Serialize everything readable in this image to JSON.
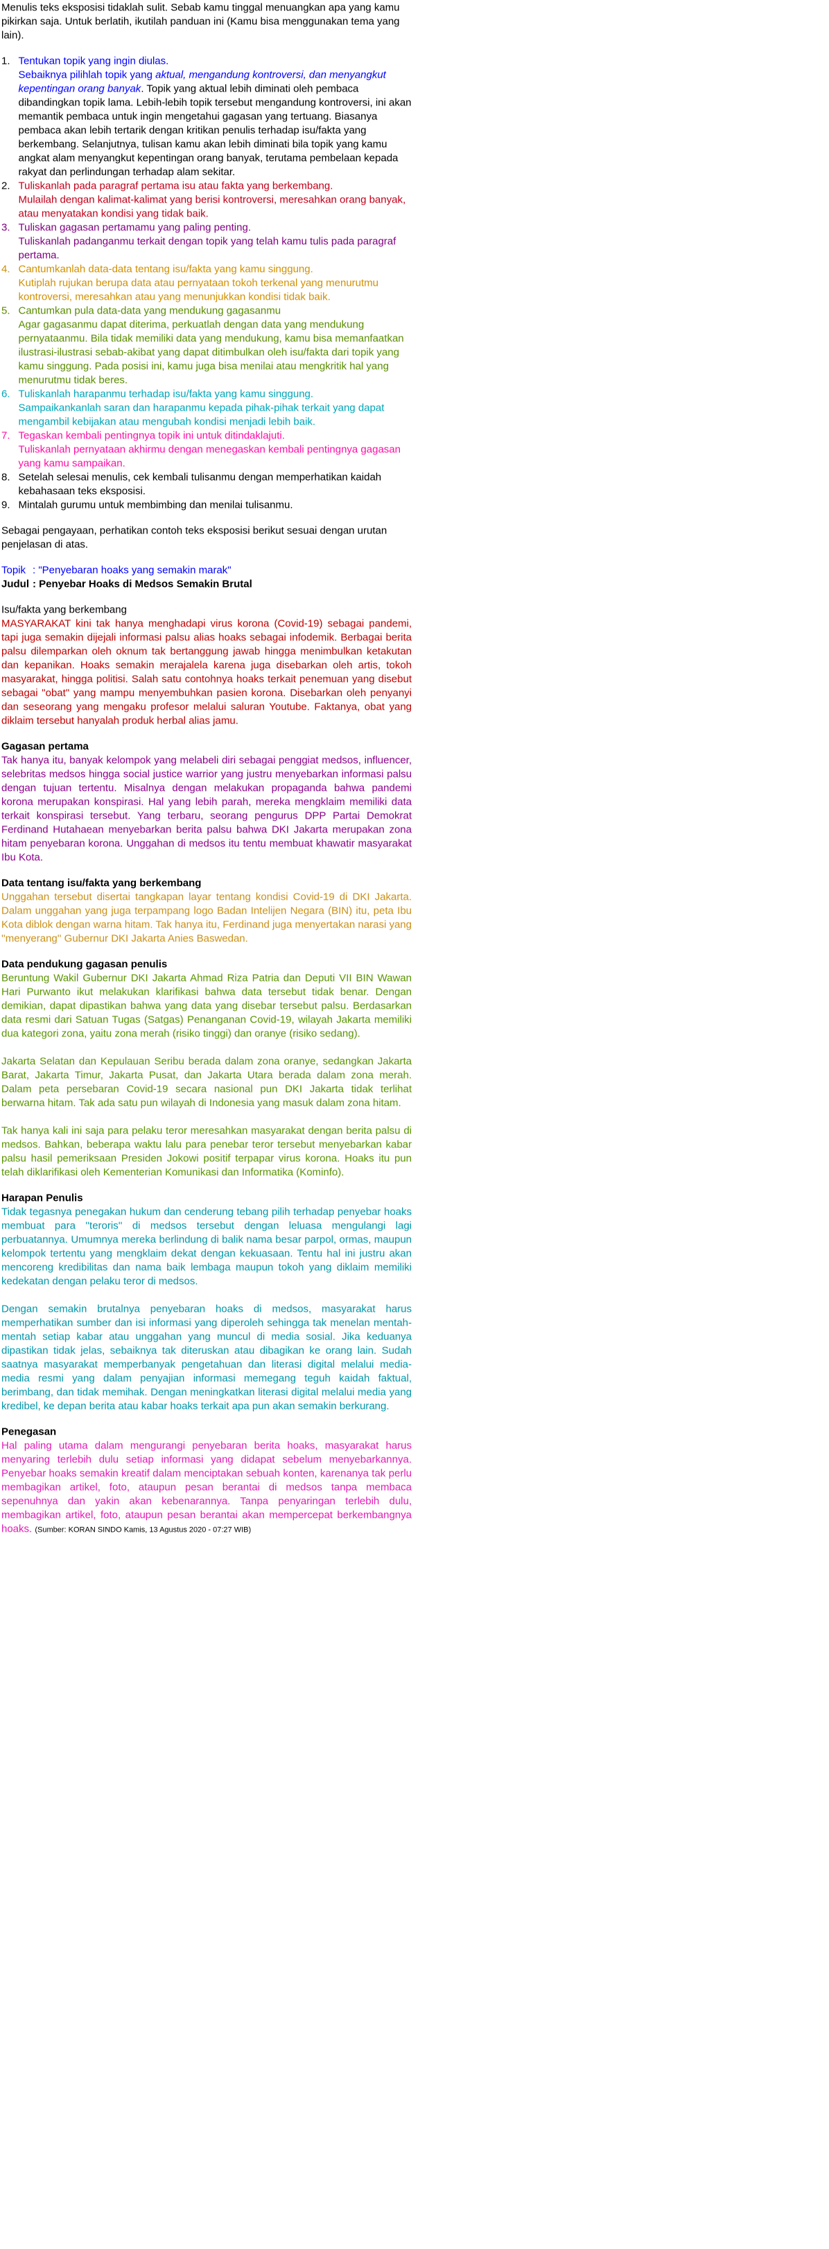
{
  "intro": "Menulis teks eksposisi tidaklah sulit. Sebab kamu tinggal menuangkan apa yang kamu pikirkan saja. Untuk berlatih, ikutilah panduan ini (Kamu bisa menggunakan tema yang lain).",
  "colors": {
    "blue": "#0000ff",
    "red": "#c0001a",
    "purple": "#800080",
    "orange": "#d19000",
    "green": "#5a8c00",
    "cyan": "#00a5b8",
    "pink": "#ff0da6"
  },
  "steps": [
    {
      "num": "1.",
      "title": "Tentukan topik yang ingin diulas.",
      "body_prefix": "Sebaiknya pilihlah topik yang ",
      "body_italic": "aktual, mengandung kontroversi, dan menyangkut  kepentingan orang banyak",
      "body_suffix": ". Topik yang aktual lebih diminati oleh pembaca dibandingkan  topik lama. Lebih-lebih topik tersebut mengandung kontroversi, ini akan memantik pembaca untuk ingin mengetahui gagasan yang tertuang. Biasanya pembaca akan lebih tertarik dengan kritikan penulis terhadap isu/fakta yang berkembang. Selanjutnya, tulisan  kamu akan lebih diminati bila topik yang kamu angkat alam menyangkut kepentingan orang banyak, terutama pembelaan kepada rakyat dan perlindungan terhadap alam sekitar."
    },
    {
      "num": "2.",
      "title": "Tuliskanlah pada paragraf pertama isu atau fakta yang berkembang.",
      "body": "Mulailah dengan kalimat-kalimat yang berisi kontroversi, meresahkan orang banyak, atau menyatakan kondisi yang tidak baik."
    },
    {
      "num": "3.",
      "title": "Tuliskan gagasan pertamamu yang paling penting.",
      "body": "Tuliskanlah padanganmu terkait dengan topik yang telah kamu tulis pada paragraf pertama."
    },
    {
      "num": "4.",
      "title": "Cantumkanlah data-data tentang isu/fakta yang kamu singgung.",
      "body": "Kutiplah rujukan berupa data atau pernyataan tokoh terkenal yang menurutmu kontroversi, meresahkan atau yang menunjukkan kondisi tidak baik."
    },
    {
      "num": "5.",
      "title": "Cantumkan pula data-data yang mendukung gagasanmu",
      "body": "Agar gagasanmu dapat diterima, perkuatlah dengan data yang mendukung pernyataanmu. Bila tidak memiliki data yang mendukung, kamu bisa memanfaatkan ilustrasi-ilustrasi sebab-akibat yang dapat ditimbulkan oleh isu/fakta dari topik yang kamu singgung. Pada posisi ini, kamu juga bisa menilai atau mengkritik hal yang menurutmu tidak beres."
    },
    {
      "num": "6.",
      "title": "Tuliskanlah harapanmu terhadap isu/fakta yang kamu singgung.",
      "body": "Sampaikankanlah saran dan harapanmu kepada pihak-pihak terkait yang dapat mengambil kebijakan atau mengubah kondisi menjadi lebih baik."
    },
    {
      "num": "7.",
      "title": "Tegaskan kembali pentingnya topik ini untuk ditindaklajuti.",
      "body": "Tuliskanlah pernyataan akhirmu dengan menegaskan kembali pentingnya gagasan yang kamu sampaikan."
    },
    {
      "num": "8.",
      "text": "Setelah selesai menulis, cek kembali tulisanmu dengan memperhatikan kaidah kebahasaan teks eksposisi."
    },
    {
      "num": "9.",
      "text": "Mintalah gurumu untuk membimbing dan menilai tulisanmu."
    }
  ],
  "enrichment": "Sebagai pengayaan, perhatikan contoh teks eksposisi berikut sesuai dengan urutan penjelasan di atas.",
  "topic_label": "Topik",
  "topic_value": ": \"Penyebaran hoaks yang semakin marak\"",
  "title_label": "Judul",
  "title_value": ": Penyebar Hoaks di Medsos Semakin Brutal",
  "sections": {
    "isu": {
      "heading": "Isu/fakta yang berkembang",
      "text": "MASYARAKAT kini tak hanya menghadapi virus korona (Covid-19) sebagai pandemi, tapi juga semakin dijejali informasi palsu alias hoaks sebagai infodemik. Berbagai berita palsu dilemparkan oleh oknum tak bertanggung jawab hingga menimbulkan ketakutan dan kepanikan. Hoaks semakin merajalela karena juga disebarkan oleh artis, tokoh masyarakat, hingga politisi. Salah satu contohnya hoaks terkait penemuan yang disebut sebagai \"obat\" yang mampu menyembuhkan pasien korona. Disebarkan oleh penyanyi dan seseorang yang mengaku profesor melalui saluran Youtube. Faktanya, obat yang diklaim tersebut hanyalah produk herbal alias jamu."
    },
    "gagasan": {
      "heading": "Gagasan pertama",
      "text": "Tak hanya itu, banyak kelompok yang melabeli diri sebagai penggiat medsos, influencer, selebritas medsos hingga social justice warrior yang justru menyebarkan informasi palsu dengan tujuan tertentu. Misalnya dengan melakukan propaganda bahwa pandemi korona merupakan konspirasi. Hal yang lebih parah, mereka mengklaim memiliki data terkait konspirasi tersebut. Yang terbaru, seorang pengurus DPP Partai Demokrat Ferdinand Hutahaean menyebarkan berita palsu bahwa DKI Jakarta merupakan zona hitam penyebaran korona. Unggahan di medsos itu tentu membuat khawatir masyarakat Ibu Kota."
    },
    "data": {
      "heading": "Data tentang isu/fakta yang berkembang",
      "text": "Unggahan tersebut disertai tangkapan layar tentang kondisi Covid-19 di DKI Jakarta. Dalam unggahan yang juga terpampang logo Badan Intelijen Negara (BIN) itu, peta Ibu Kota diblok dengan warna hitam. Tak hanya itu, Ferdinand juga menyertakan narasi yang ''menyerang'' Gubernur DKI Jakarta Anies Baswedan."
    },
    "pendukung": {
      "heading": "Data pendukung gagasan penulis",
      "p1": "Beruntung Wakil Gubernur DKI Jakarta Ahmad Riza Patria dan Deputi VII BIN Wawan Hari Purwanto ikut melakukan klarifikasi bahwa data tersebut tidak benar. Dengan demikian, dapat dipastikan bahwa yang data yang disebar tersebut palsu. Berdasarkan data resmi dari Satuan Tugas (Satgas) Penanganan Covid-19, wilayah Jakarta memiliki dua kategori zona, yaitu zona merah (risiko tinggi) dan oranye (risiko sedang).",
      "p2": "Jakarta Selatan dan Kepulauan Seribu berada dalam zona oranye, sedangkan Jakarta Barat, Jakarta Timur, Jakarta Pusat, dan Jakarta Utara berada dalam zona merah. Dalam peta persebaran Covid-19 secara nasional pun DKI Jakarta tidak terlihat berwarna hitam. Tak ada satu pun wilayah di Indonesia yang masuk dalam zona hitam.",
      "p3": "Tak hanya kali ini saja para pelaku teror meresahkan masyarakat dengan berita palsu di medsos. Bahkan, beberapa waktu lalu para penebar teror tersebut menyebarkan kabar palsu hasil pemeriksaan Presiden Jokowi positif terpapar virus korona. Hoaks itu pun telah diklarifikasi oleh Kementerian Komunikasi dan Informatika (Kominfo)."
    },
    "harapan": {
      "heading": "Harapan Penulis",
      "p1": "Tidak tegasnya penegakan hukum dan cenderung tebang pilih terhadap penyebar hoaks membuat para ''teroris'' di medsos tersebut dengan leluasa mengulangi lagi perbuatannya. Umumnya mereka berlindung di balik nama besar parpol, ormas, maupun kelompok tertentu yang mengklaim dekat dengan kekuasaan. Tentu hal ini justru akan mencoreng kredibilitas dan nama baik lembaga maupun tokoh yang diklaim memiliki kedekatan dengan pelaku teror di medsos.",
      "p2": "Dengan semakin brutalnya penyebaran hoaks di medsos, masyarakat harus memperhatikan sumber dan isi informasi yang diperoleh sehingga tak menelan mentah-mentah setiap kabar atau unggahan yang muncul di media sosial. Jika keduanya dipastikan tidak jelas, sebaiknya tak diteruskan atau dibagikan ke orang lain. Sudah saatnya masyarakat memperbanyak pengetahuan dan literasi digital melalui media-media resmi yang dalam penyajian informasi memegang teguh kaidah faktual, berimbang, dan tidak memihak. Dengan meningkatkan literasi digital melalui media yang kredibel, ke depan berita atau kabar hoaks terkait apa pun akan semakin berkurang."
    },
    "penegasan": {
      "heading": "Penegasan",
      "text": "Hal paling utama dalam mengurangi penyebaran berita hoaks, masyarakat harus menyaring terlebih dulu setiap informasi yang didapat sebelum menyebarkannya. Penyebar hoaks semakin kreatif dalam menciptakan sebuah konten, karenanya tak perlu membagikan artikel, foto, ataupun pesan berantai di medsos tanpa membaca sepenuhnya dan yakin akan kebenarannya. Tanpa penyaringan terlebih dulu, membagikan artikel, foto, ataupun pesan berantai akan mempercepat berkembangnya hoaks.",
      "source": "(Sumber: KORAN SINDO Kamis, 13 Agustus 2020 - 07:27 WIB)"
    }
  }
}
